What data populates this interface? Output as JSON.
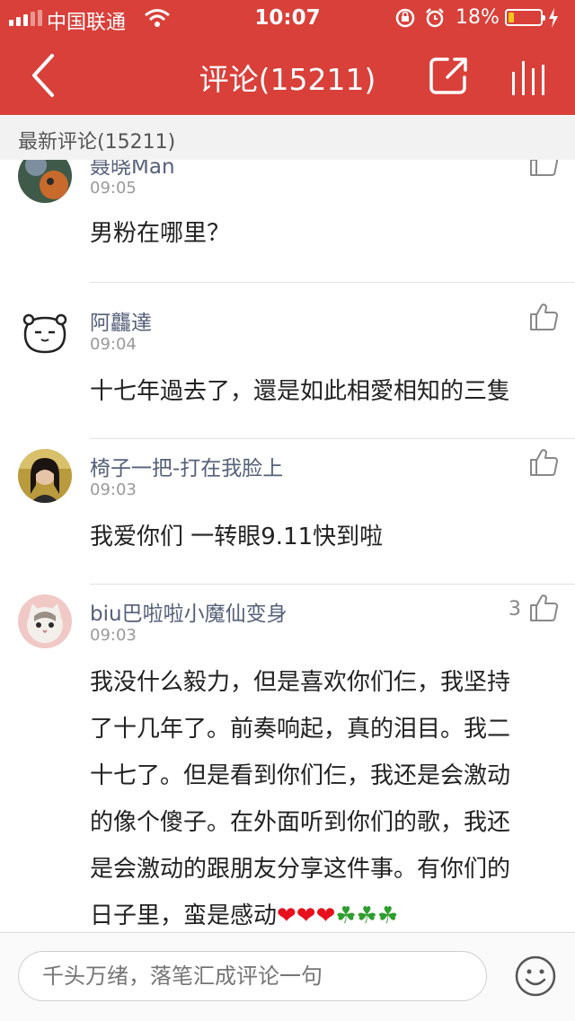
{
  "status_bar": {
    "carrier": "中国联通",
    "time": "10:07",
    "battery": "18%",
    "battery_level": 0.18
  },
  "nav": {
    "title": "评论(15211)",
    "back_icon": "chevron-left-icon",
    "share_icon": "share-icon",
    "menu_icon": "bars-icon"
  },
  "section": {
    "title": "最新评论(15211)"
  },
  "comments": [
    {
      "user": "聂晓Man",
      "time": "09:05",
      "text": "男粉在哪里？",
      "likes": ""
    },
    {
      "user": "阿龘達",
      "time": "09:04",
      "text": "十七年過去了，還是如此相愛相知的三隻",
      "likes": ""
    },
    {
      "user": "椅子一把-打在我脸上",
      "time": "09:03",
      "text": "我爱你们 一转眼9.11快到啦",
      "likes": ""
    },
    {
      "user": "biu巴啦啦小魔仙变身",
      "time": "09:03",
      "likes": "3",
      "lines": [
        "我没什么毅力，但是喜欢你们仨，我坚持",
        "了十几年了。前奏响起，真的泪目。我二",
        "十七了。但是看到你们仨，我还是会激动",
        "的像个傻子。在外面听到你们的歌，我还",
        "是会激动的跟朋友分享这件事。有你们的",
        "日子里，蛮是感动"
      ],
      "emoji_hearts": "❤❤❤",
      "emoji_clovers": "☘☘☘"
    }
  ],
  "input": {
    "placeholder": "千头万绪，落笔汇成评论一句"
  },
  "colors": {
    "brand_red": "#d9403a",
    "username": "#55607a"
  }
}
